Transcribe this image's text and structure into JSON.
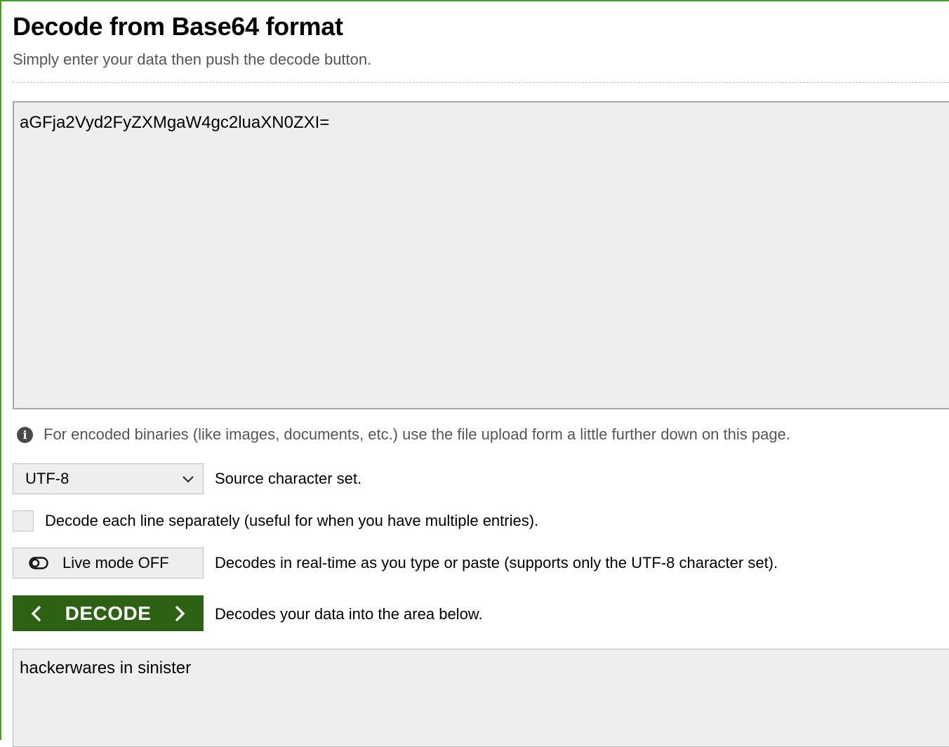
{
  "header": {
    "title": "Decode from Base64 format",
    "subtitle": "Simply enter your data then push the decode button."
  },
  "input": {
    "value": "aGFja2Vyd2FyZXMgaW4gc2luaXN0ZXI="
  },
  "info": {
    "icon": "info-icon",
    "glyph": "i",
    "text": "For encoded binaries (like images, documents, etc.) use the file upload form a little further down on this page."
  },
  "charset": {
    "selected": "UTF-8",
    "label": "Source character set."
  },
  "line_by_line": {
    "checked": false,
    "label": "Decode each line separately (useful for when you have multiple entries)."
  },
  "live_mode": {
    "button_label": "Live mode OFF",
    "description": "Decodes in real-time as you type or paste (supports only the UTF-8 character set)."
  },
  "decode": {
    "button_label": "DECODE",
    "description": "Decodes your data into the area below.",
    "color": "#2d6113"
  },
  "output": {
    "value": "hackerwares in sinister"
  },
  "colors": {
    "accent_border": "#4c9a2a",
    "field_background": "#eeeeee"
  }
}
